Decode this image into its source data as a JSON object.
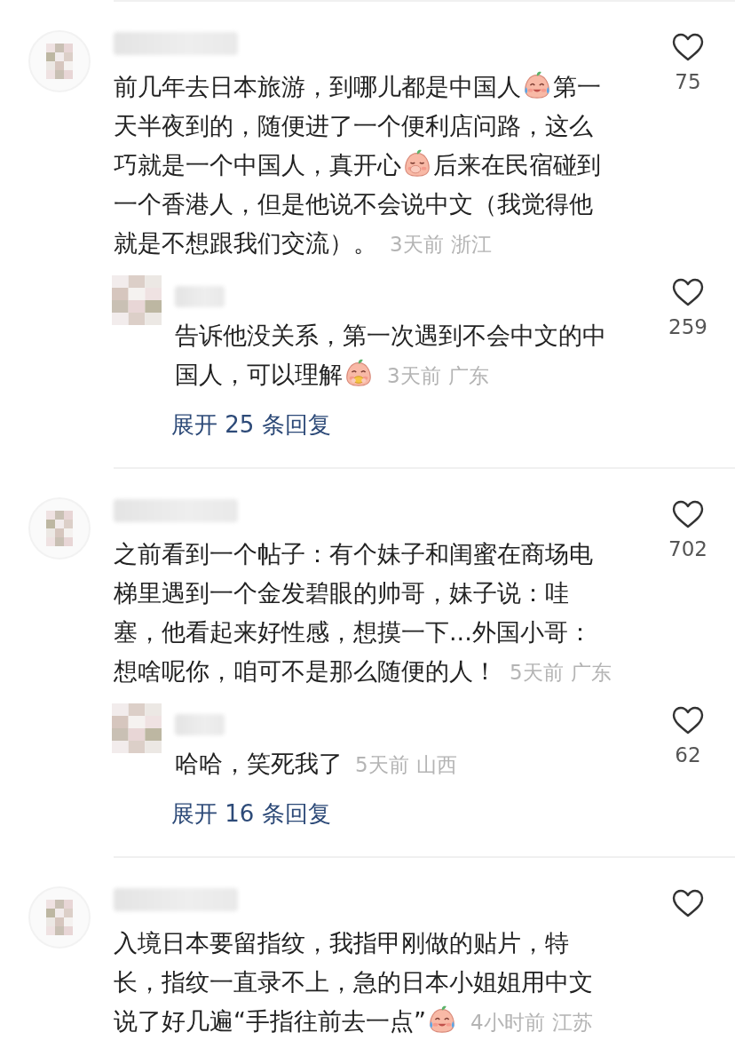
{
  "comments": [
    {
      "lines": [
        [
          {
            "kind": "text",
            "text": "前几年去日本旅游，到哪儿都是中国人"
          },
          {
            "kind": "tears-emoji"
          },
          {
            "kind": "text",
            "text": "第一"
          }
        ],
        [
          {
            "kind": "text",
            "text": "天半夜到的，随便进了一个便利店问路，这么"
          }
        ],
        [
          {
            "kind": "text",
            "text": "巧就是一个中国人，真开心"
          },
          {
            "kind": "giggle-emoji"
          },
          {
            "kind": "text",
            "text": "后来在民宿碰到"
          }
        ],
        [
          {
            "kind": "text",
            "text": "一个香港人，但是他说不会说中文（我觉得他"
          }
        ],
        [
          {
            "kind": "text",
            "text": "就是不想跟我们交流）。"
          }
        ]
      ],
      "time": "3天前",
      "location": "浙江",
      "likes": "75",
      "replies": [
        {
          "lines": [
            [
              {
                "kind": "text",
                "text": "告诉他没关系，第一次遇到不会中文的中"
              }
            ],
            [
              {
                "kind": "text",
                "text": "国人，可以理解"
              },
              {
                "kind": "hug-emoji"
              }
            ]
          ],
          "time": "3天前",
          "location": "广东",
          "likes": "259"
        }
      ],
      "expand": "展开 25 条回复"
    },
    {
      "lines": [
        [
          {
            "kind": "text",
            "text": "之前看到一个帖子：有个妹子和闺蜜在商场电"
          }
        ],
        [
          {
            "kind": "text",
            "text": "梯里遇到一个金发碧眼的帅哥，妹子说：哇"
          }
        ],
        [
          {
            "kind": "text",
            "text": "塞，他看起来好性感，想摸一下...外国小哥："
          }
        ],
        [
          {
            "kind": "text",
            "text": "想啥呢你，咱可不是那么随便的人！"
          }
        ]
      ],
      "time": "5天前",
      "location": "广东",
      "likes": "702",
      "replies": [
        {
          "lines": [
            [
              {
                "kind": "text",
                "text": "哈哈，笑死我了"
              }
            ]
          ],
          "time": "5天前",
          "location": "山西",
          "likes": "62"
        }
      ],
      "expand": "展开 16 条回复"
    },
    {
      "lines": [
        [
          {
            "kind": "text",
            "text": "入境日本要留指纹，我指甲刚做的贴片，特"
          }
        ],
        [
          {
            "kind": "text",
            "text": "长，指纹一直录不上，急的日本小姐姐用中文"
          }
        ],
        [
          {
            "kind": "text",
            "text": "说了好几遍“手指往前去一点”"
          },
          {
            "kind": "tears-emoji"
          }
        ]
      ],
      "time": "4小时前",
      "location": "江苏"
    }
  ]
}
